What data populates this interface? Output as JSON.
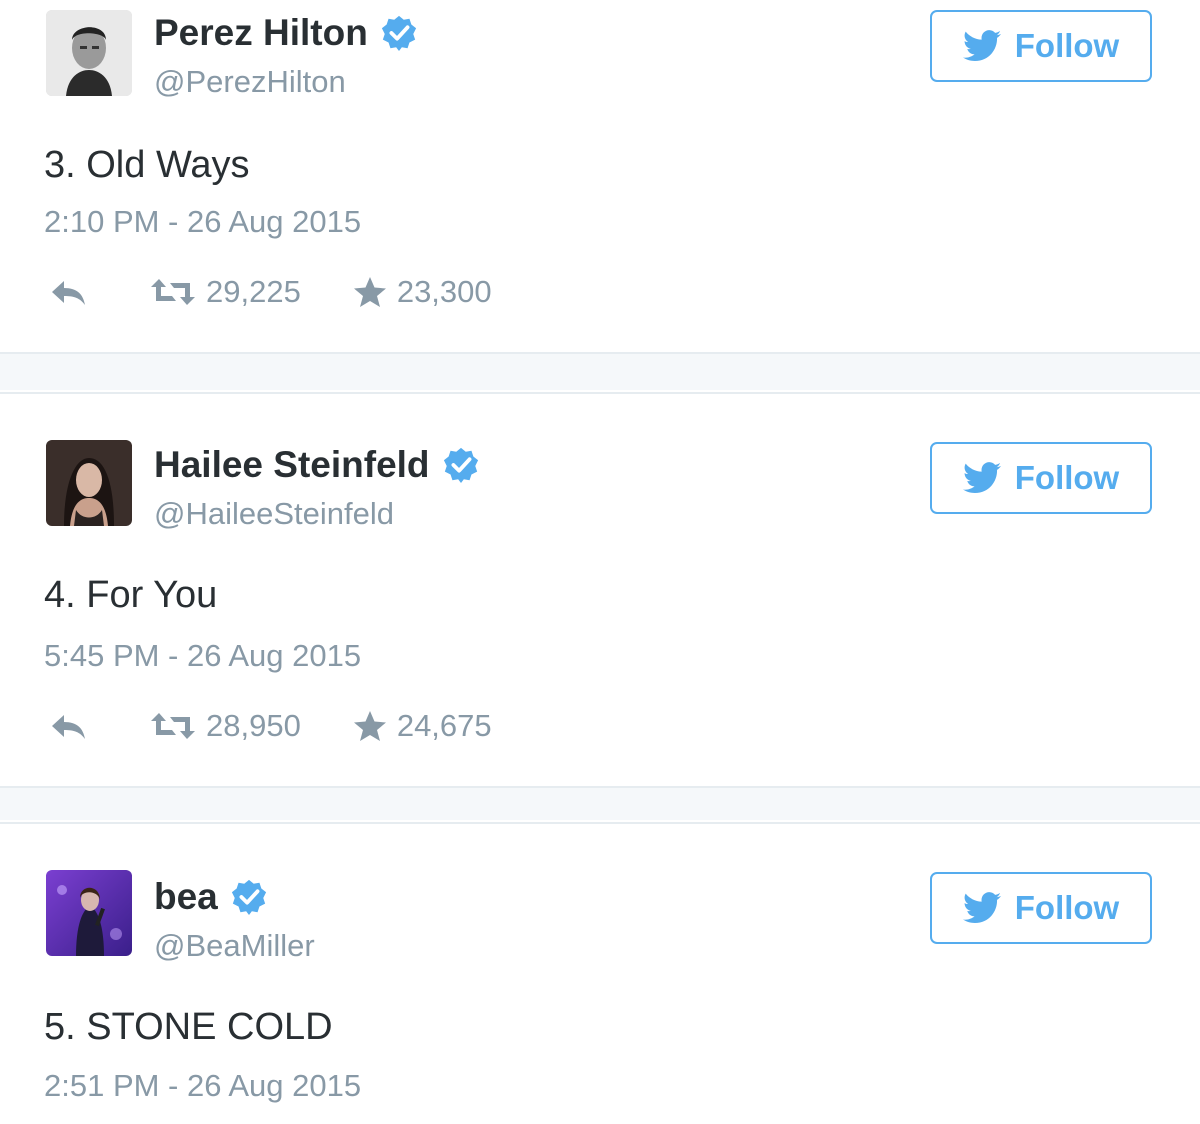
{
  "tweets": [
    {
      "name": "Perez Hilton",
      "handle": "@PerezHilton",
      "follow_label": "Follow",
      "text": "3. Old Ways",
      "timestamp": "2:10 PM - 26 Aug 2015",
      "retweets": "29,225",
      "favorites": "23,300"
    },
    {
      "name": "Hailee Steinfeld",
      "handle": "@HaileeSteinfeld",
      "follow_label": "Follow",
      "text": "4. For You",
      "timestamp": "5:45 PM - 26 Aug 2015",
      "retweets": "28,950",
      "favorites": "24,675"
    },
    {
      "name": "bea",
      "handle": "@BeaMiller",
      "follow_label": "Follow",
      "text": "5. STONE COLD",
      "timestamp": "2:51 PM - 26 Aug 2015"
    }
  ],
  "icons": {
    "verified": "verified-badge-icon",
    "follow": "twitter-bird-icon",
    "reply": "reply-icon",
    "retweet": "retweet-icon",
    "favorite": "star-icon"
  },
  "colors": {
    "accent": "#55acee",
    "text": "#292f33",
    "muted": "#8899a6",
    "divider": "#e6ecf0"
  }
}
